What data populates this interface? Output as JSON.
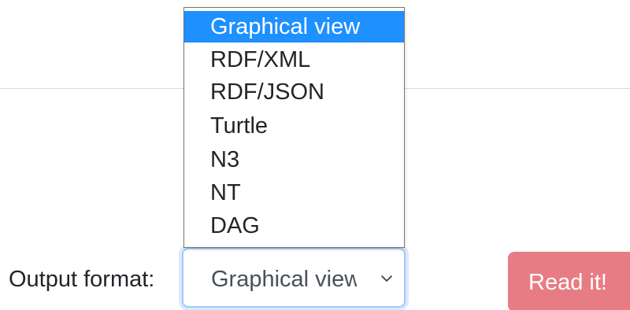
{
  "form": {
    "output_label": "Output format:",
    "select": {
      "selected_value": "Graphical view",
      "options": [
        "Graphical view",
        "RDF/XML",
        "RDF/JSON",
        "Turtle",
        "N3",
        "NT",
        "DAG"
      ]
    },
    "read_button_label": "Read it!"
  },
  "colors": {
    "highlight": "#1e90ff",
    "button": "#e87c84",
    "focus_border": "#9ecbf7"
  },
  "icons": {
    "select_arrow": "chevron-down-icon"
  }
}
